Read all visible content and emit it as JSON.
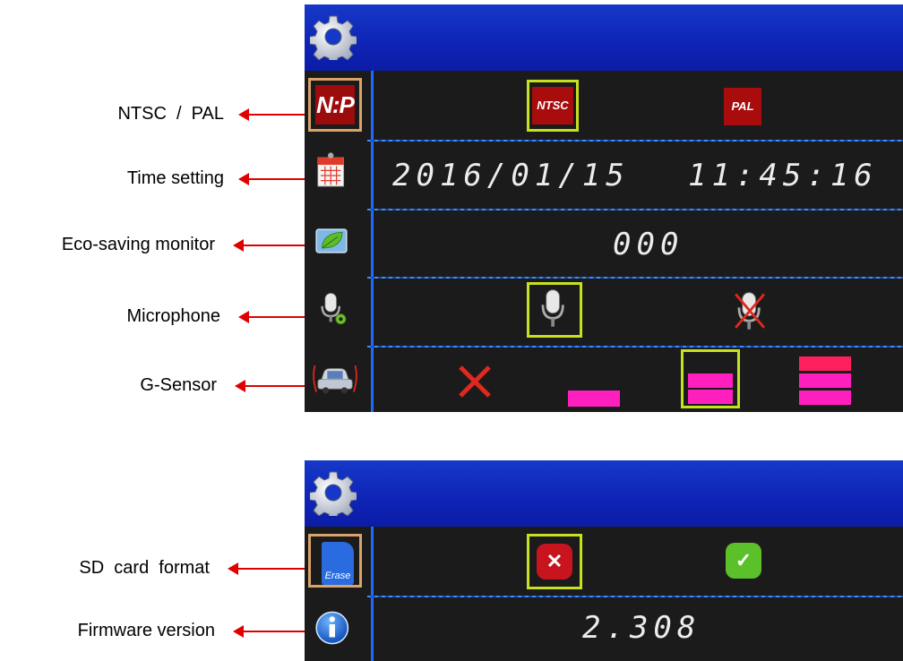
{
  "callouts": {
    "ntsc_pal": "NTSC  /  PAL",
    "time_setting": "Time setting",
    "eco_saving_monitor": "Eco-saving monitor",
    "microphone": "Microphone",
    "g_sensor": "G-Sensor",
    "sd_card_format": "SD  card  format",
    "firmware_version": "Firmware version"
  },
  "screen1": {
    "title_icon": "gear-icon",
    "ntsc_pal_row": {
      "icon_text": "N:P",
      "options": [
        "NTSC",
        "PAL"
      ],
      "selected": "NTSC"
    },
    "time_row": {
      "icon": "calendar-icon",
      "date": "2016/01/15",
      "time": "11:45:16"
    },
    "eco_row": {
      "icon": "leaf-monitor-icon",
      "value": "000"
    },
    "mic_row": {
      "icon": "microphone-settings-icon",
      "options": [
        "microphone-on-icon",
        "microphone-off-icon"
      ],
      "selected": "microphone-on-icon"
    },
    "gsensor_row": {
      "icon": "car-shake-icon",
      "levels": [
        "off",
        "low",
        "medium",
        "high"
      ],
      "selected": "medium"
    }
  },
  "screen2": {
    "title_icon": "gear-icon",
    "sd_row": {
      "icon_text": "Erase",
      "options": [
        "cancel",
        "confirm"
      ],
      "selected": "cancel"
    },
    "firmware_row": {
      "icon": "info-icon",
      "version": "2.308"
    }
  },
  "colors": {
    "title_blue": "#1638c8",
    "highlight_yellow": "#c8e11e",
    "selected_icon_border": "#d9a36a",
    "arrow_red": "#e00000"
  }
}
